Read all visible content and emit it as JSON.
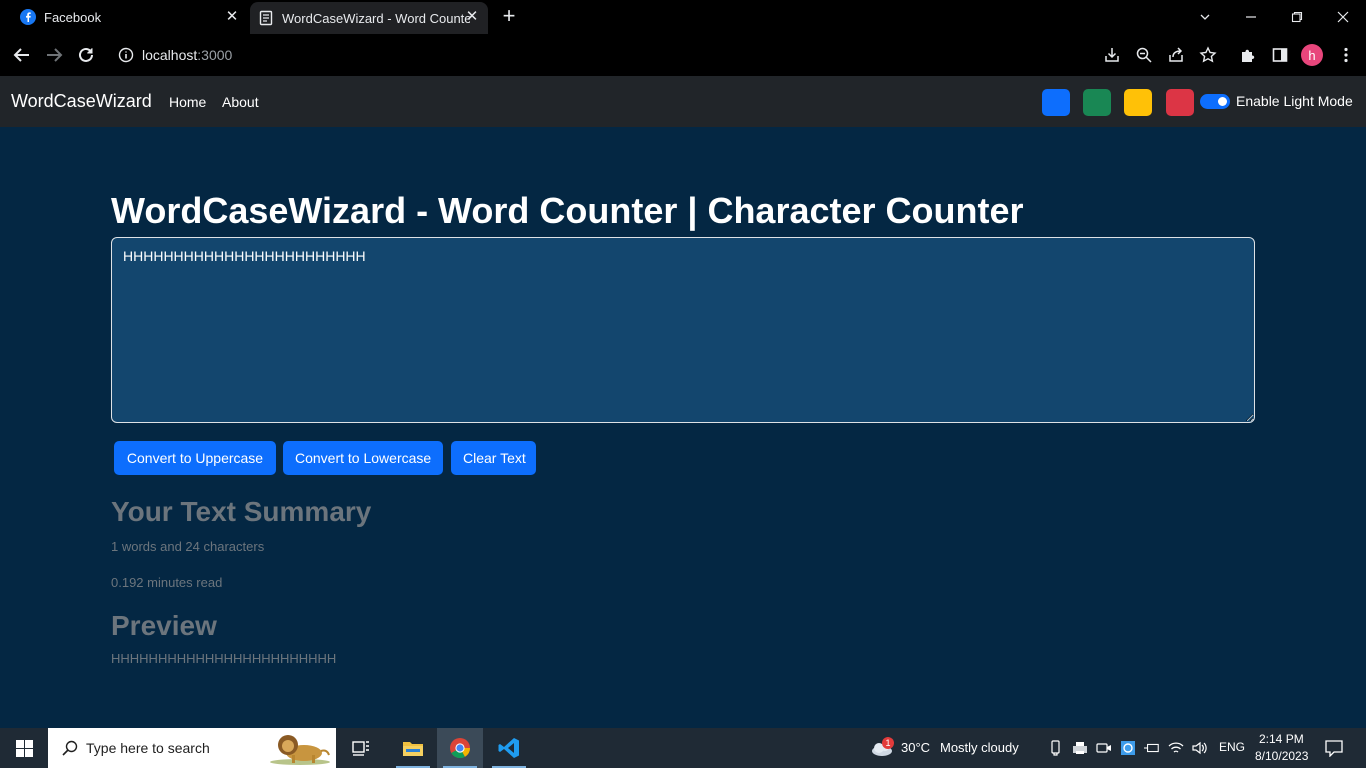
{
  "browser": {
    "tabs": [
      {
        "title": "Facebook",
        "icon": "facebook-icon"
      },
      {
        "title": "WordCaseWizard - Word Counter",
        "icon": "document-icon",
        "active": true
      }
    ],
    "address": {
      "host": "localhost",
      "port": ":3000"
    },
    "profile_initial": "h"
  },
  "navbar": {
    "brand": "WordCaseWizard",
    "links": [
      "Home",
      "About"
    ],
    "swatches": [
      "#0d6efd",
      "#198754",
      "#ffc107",
      "#dc3545"
    ],
    "toggle_label": "Enable Light Mode"
  },
  "main": {
    "heading": "WordCaseWizard - Word Counter | Character Counter",
    "text_value": "HHHHHHHHHHHHHHHHHHHHHHHH",
    "buttons": {
      "uppercase": "Convert to Uppercase",
      "lowercase": "Convert to Lowercase",
      "clear": "Clear Text"
    },
    "summary_heading": "Your Text Summary",
    "summary_counts": "1 words and 24 characters",
    "summary_read": "0.192 minutes read",
    "preview_heading": "Preview",
    "preview_text": "HHHHHHHHHHHHHHHHHHHHHHHH"
  },
  "taskbar": {
    "search_placeholder": "Type here to search",
    "weather_badge": "1",
    "weather_temp": "30°C",
    "weather_desc": "Mostly cloudy",
    "language": "ENG",
    "time": "2:14 PM",
    "date": "8/10/2023"
  },
  "colors": {
    "page_bg": "#042743",
    "textarea_bg": "#13466e",
    "navbar_bg": "#212529",
    "button_primary": "#0d6efd"
  }
}
